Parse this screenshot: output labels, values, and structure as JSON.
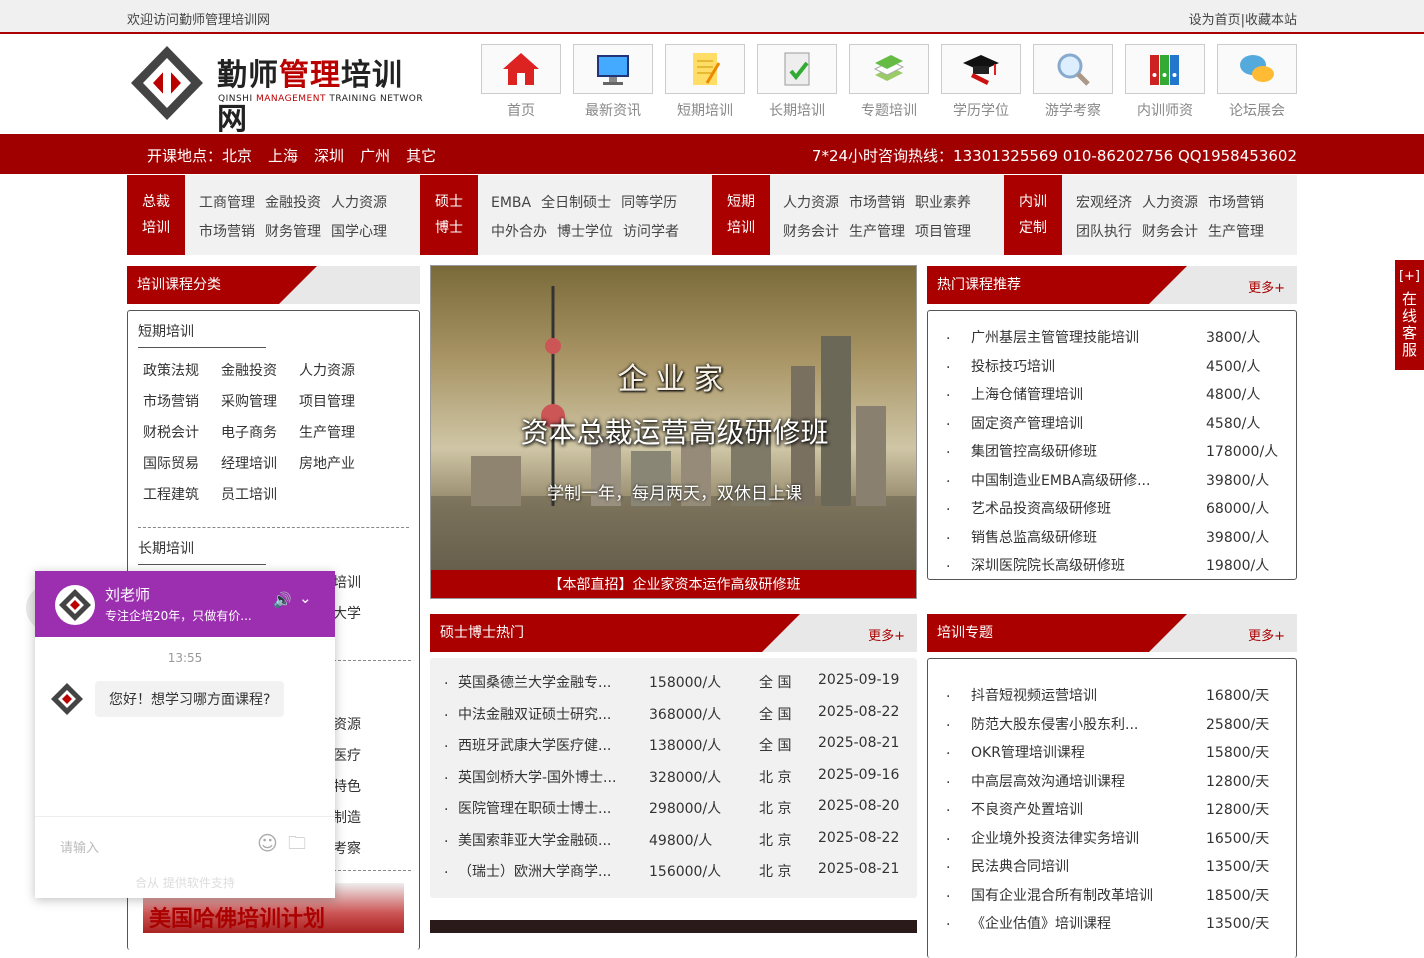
{
  "topbar": {
    "welcome": "欢迎访问勤师管理培训网",
    "links": "设为首页|收藏本站"
  },
  "logo": {
    "name_a": "勤师",
    "name_b": "管理",
    "name_c": "培训网",
    "en_a": "QINSHI ",
    "en_b": "MANAGEMENT",
    "en_c": " TRAINING NETWOR"
  },
  "nav": [
    {
      "label": "首页",
      "icon": "home-icon"
    },
    {
      "label": "最新资讯",
      "icon": "monitor-icon"
    },
    {
      "label": "短期培训",
      "icon": "notepad-icon"
    },
    {
      "label": "长期培训",
      "icon": "checklist-icon"
    },
    {
      "label": "专题培训",
      "icon": "books-icon"
    },
    {
      "label": "学历学位",
      "icon": "graduation-cap-icon"
    },
    {
      "label": "游学考察",
      "icon": "magnifier-icon"
    },
    {
      "label": "内训师资",
      "icon": "binders-icon"
    },
    {
      "label": "论坛展会",
      "icon": "chat-bubbles-icon"
    }
  ],
  "locations": {
    "prefix": "开课地点：",
    "cities": [
      "北京",
      "上海",
      "深圳",
      "广州",
      "其它"
    ]
  },
  "hotline": "7*24小时咨询热线：13301325569  010-86202756  QQ1958453602",
  "categories": [
    {
      "tag1": "总裁",
      "tag2": "培训",
      "row1": [
        "工商管理",
        "金融投资",
        "人力资源"
      ],
      "row2": [
        "市场营销",
        "财务管理",
        "国学心理"
      ]
    },
    {
      "tag1": "硕士",
      "tag2": "博士",
      "row1": [
        "EMBA",
        "全日制硕士",
        "同等学历"
      ],
      "row2": [
        "中外合办",
        "博士学位",
        "访问学者"
      ]
    },
    {
      "tag1": "短期",
      "tag2": "培训",
      "row1": [
        "人力资源",
        "市场营销",
        "职业素养"
      ],
      "row2": [
        "财务会计",
        "生产管理",
        "项目管理"
      ]
    },
    {
      "tag1": "内训",
      "tag2": "定制",
      "row1": [
        "宏观经济",
        "人力资源",
        "市场营销"
      ],
      "row2": [
        "团队执行",
        "财务会计",
        "生产管理"
      ]
    }
  ],
  "left": {
    "title": "培训课程分类",
    "short_title": "短期培训",
    "short_items": [
      "政策法规",
      "金融投资",
      "人力资源",
      "市场营销",
      "采购管理",
      "项目管理",
      "财税会计",
      "电子商务",
      "生产管理",
      "国际贸易",
      "经理培训",
      "房地产业",
      "工程建筑",
      "员工培训"
    ],
    "long_title": "长期培训",
    "partial": [
      "培训",
      "大学",
      "资源",
      "医疗",
      "特色",
      "制造",
      "考察"
    ],
    "img_text": "美国哈佛培训计划"
  },
  "banner": {
    "t1": "企业家",
    "t2": "资本总裁运营高级研修班",
    "t3": "学制一年，每月两天，双休日上课",
    "caption": "【本部直招】企业家资本运作高级研修班"
  },
  "hot": {
    "title": "热门课程推荐",
    "more": "更多+",
    "items": [
      {
        "name": "广州基层主管管理技能培训",
        "price": "3800/人"
      },
      {
        "name": "投标技巧培训",
        "price": "4500/人"
      },
      {
        "name": "上海仓储管理培训",
        "price": "4800/人"
      },
      {
        "name": "固定资产管理培训",
        "price": "4580/人"
      },
      {
        "name": "集团管控高级研修班",
        "price": "178000/人"
      },
      {
        "name": "中国制造业EMBA高级研修...",
        "price": "39800/人"
      },
      {
        "name": "艺术品投资高级研修班",
        "price": "68000/人"
      },
      {
        "name": "销售总监高级研修班",
        "price": "39800/人"
      },
      {
        "name": "深圳医院院长高级研修班",
        "price": "19800/人"
      }
    ]
  },
  "master": {
    "title": "硕士博士热门",
    "more": "更多+",
    "items": [
      {
        "name": "英国桑德兰大学金融专...",
        "price": "158000/人",
        "city": "全 国",
        "date": "2025-09-19"
      },
      {
        "name": "中法金融双证硕士研究...",
        "price": "368000/人",
        "city": "全 国",
        "date": "2025-08-22"
      },
      {
        "name": "西班牙武康大学医疗健...",
        "price": "138000/人",
        "city": "全 国",
        "date": "2025-08-21"
      },
      {
        "name": "英国剑桥大学-国外博士...",
        "price": "328000/人",
        "city": "北 京",
        "date": "2025-09-16"
      },
      {
        "name": "医院管理在职硕士博士...",
        "price": "298000/人",
        "city": "北 京",
        "date": "2025-08-20"
      },
      {
        "name": "美国索菲亚大学金融硕...",
        "price": "49800/人",
        "city": "北 京",
        "date": "2025-08-22"
      },
      {
        "name": "（瑞士）欧洲大学商学...",
        "price": "156000/人",
        "city": "北 京",
        "date": "2025-08-21"
      }
    ]
  },
  "topics": {
    "title": "培训专题",
    "more": "更多+",
    "items": [
      {
        "name": "抖音短视频运营培训",
        "price": "16800/天"
      },
      {
        "name": "防范大股东侵害小股东利...",
        "price": "25800/天"
      },
      {
        "name": "OKR管理培训课程",
        "price": "15800/天"
      },
      {
        "name": "中高层高效沟通培训课程",
        "price": "12800/天"
      },
      {
        "name": "不良资产处置培训",
        "price": "12800/天"
      },
      {
        "name": "企业境外投资法律实务培训",
        "price": "16500/天"
      },
      {
        "name": "民法典合同培训",
        "price": "13500/天"
      },
      {
        "name": "国有企业混合所有制改革培训",
        "price": "18500/天"
      },
      {
        "name": "《企业估值》培训课程",
        "price": "13500/天"
      }
    ]
  },
  "chat": {
    "name": "刘老师",
    "sub": "专注企培20年，只做有价...",
    "time": "13:55",
    "message": "您好！想学习哪方面课程?",
    "placeholder": "请输入",
    "powered": "合从 提供软件支持"
  },
  "side": {
    "plus": "[+]",
    "text": "在线客服"
  }
}
